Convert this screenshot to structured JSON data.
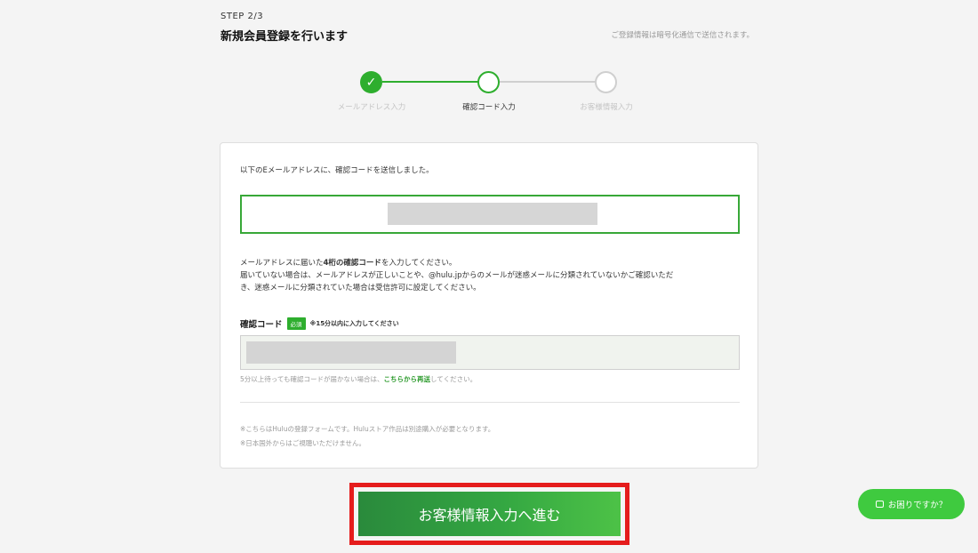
{
  "header": {
    "step": "STEP 2/3",
    "title": "新規会員登録を行います",
    "secure_note": "ご登録情報は暗号化通信で送信されます。"
  },
  "progress": {
    "steps": [
      {
        "label": "メールアドレス入力",
        "state": "done"
      },
      {
        "label": "確認コード入力",
        "state": "current"
      },
      {
        "label": "お客様情報入力",
        "state": "todo"
      }
    ],
    "check_glyph": "✓"
  },
  "card": {
    "sent_text": "以下のEメールアドレスに、確認コードを送信しました。",
    "instructions": {
      "line1_prefix": "メールアドレスに届いた",
      "line1_bold": "4桁の確認コード",
      "line1_suffix": "を入力してください。",
      "line2": "届いていない場合は、メールアドレスが正しいことや、@hulu.jpからのメールが迷惑メールに分類されていないかご確認いただ",
      "line3": "き、迷惑メールに分類されていた場合は受信許可に設定してください。"
    },
    "code_field": {
      "label": "確認コード",
      "required_badge": "必須",
      "time_note": "※15分以内に入力してください"
    },
    "resend": {
      "prefix": "5分以上待っても確認コードが届かない場合は、",
      "link": "こちらから再送",
      "suffix": "してください。"
    },
    "notes": [
      "※こちらはHuluの登録フォームです。Huluストア作品は別途購入が必要となります。",
      "※日本国外からはご視聴いただけません。"
    ]
  },
  "submit": {
    "label": "お客様情報入力へ進む"
  },
  "help": {
    "label": "お困りですか？"
  },
  "colors": {
    "accent_green": "#2eae2e",
    "highlight_red": "#e51c1c"
  }
}
